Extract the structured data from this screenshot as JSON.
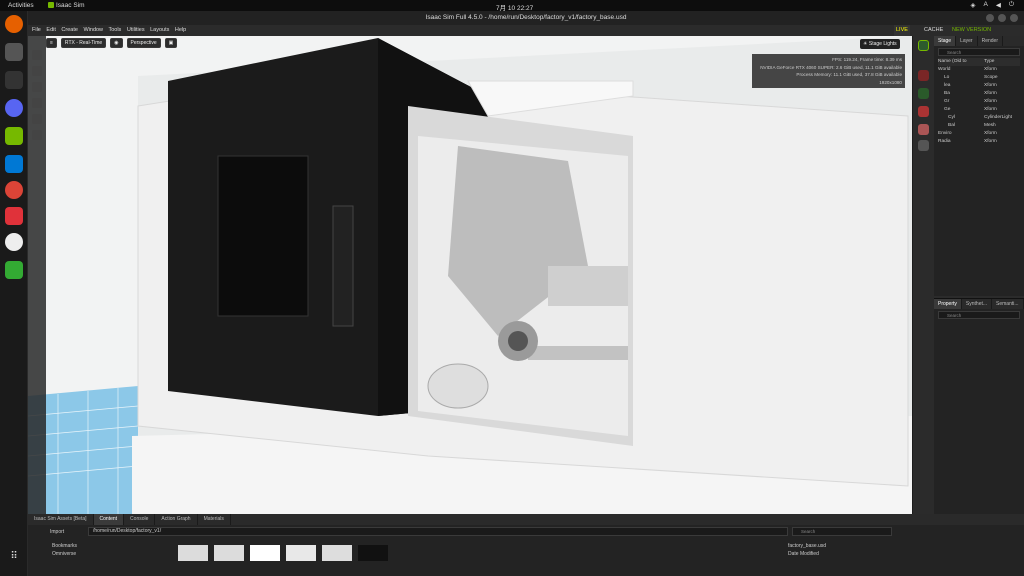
{
  "topbar": {
    "activities": "Activities",
    "app_name": "Isaac Sim",
    "clock": "7月 10  22:27"
  },
  "window": {
    "title": "Isaac Sim Full 4.5.0 - /home/run/Desktop/factory_v1/factory_base.usd"
  },
  "menu": [
    "File",
    "Edit",
    "Create",
    "Window",
    "Tools",
    "Utilities",
    "Layouts",
    "Help"
  ],
  "menu_right": {
    "live": "LIVE",
    "cache": "CACHE",
    "notice": "NEW VERSION DETECTED"
  },
  "viewport": {
    "render_mode": "RTX - Real-Time",
    "camera": "Perspective",
    "stage_lights": "Stage Lights"
  },
  "stats": [
    "FPS: 119.24, Frame time: 8.39 ms",
    "NVIDIA GeForce RTX 4060 SUPER: 2.6 GiB used, 11.1 GiB available",
    "Process Memory: 11.1 GiB used, 37.8 GiB available",
    "1920x1080"
  ],
  "stage": {
    "tabs": [
      "Stage",
      "Layer",
      "Render"
    ],
    "search_placeholder": "Search",
    "col_name": "Name (Old to",
    "col_type": "Type",
    "rows": [
      {
        "name": "World",
        "type": "Xform"
      },
      {
        "name": "Lo",
        "type": "Scope"
      },
      {
        "name": "lea",
        "type": "Xform"
      },
      {
        "name": "Ba",
        "type": "Xform"
      },
      {
        "name": "Gr",
        "type": "Xform"
      },
      {
        "name": "Ge",
        "type": "Xform"
      },
      {
        "name": "Cyl",
        "type": "CylinderLight"
      },
      {
        "name": "Bal",
        "type": "Mesh"
      },
      {
        "name": "Enviro",
        "type": "Xform"
      },
      {
        "name": "Radia",
        "type": "Xform"
      }
    ]
  },
  "property": {
    "tabs": [
      "Property",
      "Synthet...",
      "Semanti..."
    ],
    "search_placeholder": "Search"
  },
  "bottom": {
    "tabs": [
      "Isaac Sim Assets [Beta]",
      "Content",
      "Console",
      "Action Graph",
      "Materials"
    ],
    "import": "Import",
    "path": "/home/run/Desktop/factory_v1/",
    "tree": [
      "Bookmarks",
      "Omniverse"
    ],
    "search_placeholder": "Search",
    "file": "factory_base.usd",
    "file_meta": "Date Modified"
  }
}
